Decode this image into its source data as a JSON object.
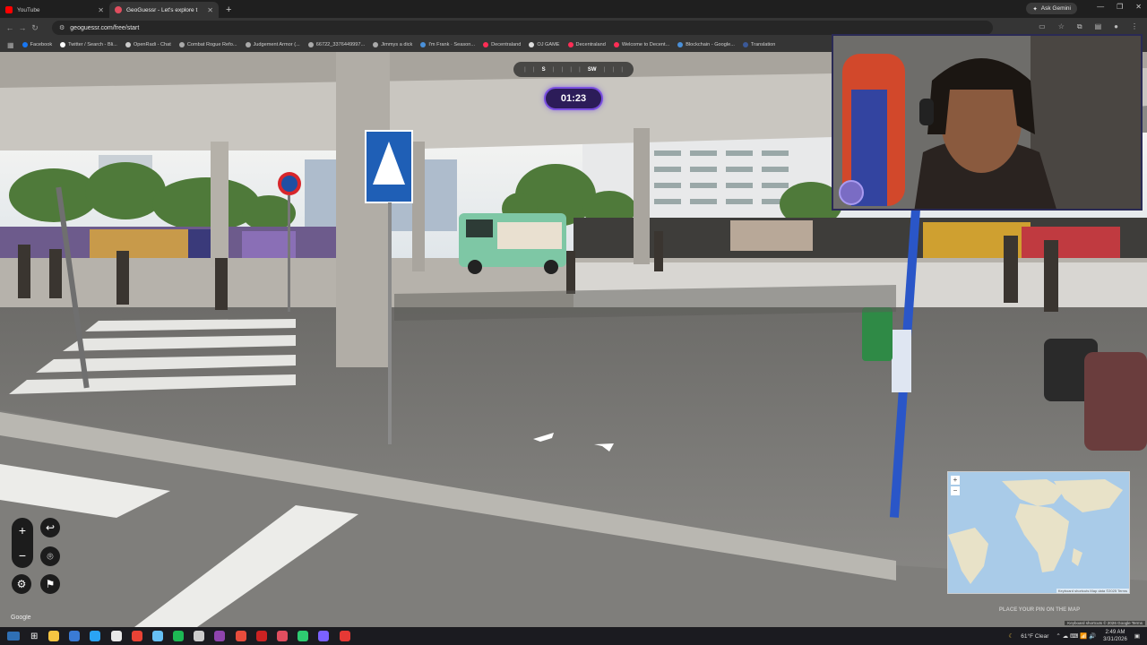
{
  "browser": {
    "tabs": [
      {
        "title": "YouTube",
        "icon": "youtube-icon",
        "color": "#ff0000",
        "active": false
      },
      {
        "title": "GeoGuessr - Let's explore t",
        "icon": "geoguessr-icon",
        "color": "#e04e5f",
        "active": true
      }
    ],
    "ask_gemini": "Ask Gemini",
    "url": "geoguessr.com/free/start",
    "bookmarks": [
      {
        "label": "Facebook",
        "color": "#1877f2"
      },
      {
        "label": "Twitter / Search - Bli...",
        "color": "#ffffff"
      },
      {
        "label": "OpenRadi - Chat",
        "color": "#cccccc"
      },
      {
        "label": "Combat Rogue Refo...",
        "color": "#aaaaaa"
      },
      {
        "label": "Judgement Armor (...",
        "color": "#aaaaaa"
      },
      {
        "label": "66722_3376449997...",
        "color": "#aaaaaa"
      },
      {
        "label": "Jimmys a dick",
        "color": "#aaaaaa"
      },
      {
        "label": "I'm Frank · Season...",
        "color": "#4a90d9"
      },
      {
        "label": "Decentraland",
        "color": "#ff2d55"
      },
      {
        "label": "OJ GAME",
        "color": "#dddddd"
      },
      {
        "label": "Decentraland",
        "color": "#ff2d55"
      },
      {
        "label": "Welcome to Decent...",
        "color": "#ff2d55"
      },
      {
        "label": "Blockchain - Google...",
        "color": "#4a90d9"
      },
      {
        "label": "Translation",
        "color": "#3b5998"
      }
    ]
  },
  "game": {
    "compass": [
      "S",
      "SW"
    ],
    "timer": "01:23",
    "google_logo": "Google",
    "place_pin": "PLACE YOUR PIN ON THE MAP",
    "map_footer": "Keyboard shortcuts   Map data ©2025   Terms",
    "attribution": "Keyboard shortcuts   © 2026 Google   Terms",
    "accent": "#7a4fe0"
  },
  "taskbar": {
    "weather": "61°F  Clear",
    "time": "2:49 AM",
    "date": "3/31/2026",
    "apps": [
      "#f5c542",
      "#3a7bd5",
      "#2aa4f4",
      "#e8e8e8",
      "#ea4335",
      "#66c0f4",
      "#1db954",
      "#cccccc",
      "#8e44ad",
      "#e74c3c",
      "#cc2222",
      "#e04e5f",
      "#2ecc71",
      "#7b61ff",
      "#e53935"
    ]
  }
}
